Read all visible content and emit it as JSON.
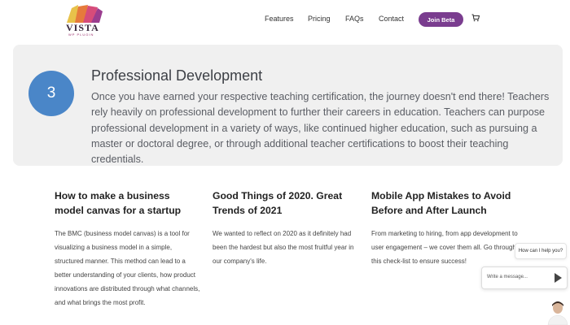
{
  "brand": {
    "name": "VISTA",
    "tagline": "WP PLUGIN"
  },
  "nav": {
    "features": "Features",
    "pricing": "Pricing",
    "faqs": "FAQs",
    "contact": "Contact",
    "join": "Join Beta"
  },
  "feature": {
    "step": "3",
    "title": "Professional Development",
    "body": "Once you have earned your respective teaching certification, the journey doesn't end there! Teachers rely heavily on professional development to further their careers in education. Teachers can purpose professional development in a variety of ways, like continued higher education, such as pursuing a master or doctoral degree, or through additional teacher certifications to boost their teaching credentials."
  },
  "articles": [
    {
      "title": "How to make a business model canvas for a startup",
      "text": "The BMC (business model canvas) is a tool for visualizing a business model in a simple, structured manner. This method can lead to a better understanding of your clients, how product innovations are distributed through what channels, and what brings the most profit."
    },
    {
      "title": "Good Things of 2020. Great Trends of 2021",
      "text": "We wanted to reflect on 2020 as it definitely had been the hardest but also the most fruitful year in our company's life."
    },
    {
      "title": "Mobile App Mistakes to Avoid Before and After Launch",
      "text": "From marketing to hiring, from app development to user engagement – we cover them all. Go through this check-list to ensure success!"
    }
  ],
  "chat": {
    "prompt": "How can I help you?",
    "placeholder": "Write a message..."
  },
  "colors": {
    "accent": "#7a3d8f",
    "step": "#4a86c8"
  }
}
